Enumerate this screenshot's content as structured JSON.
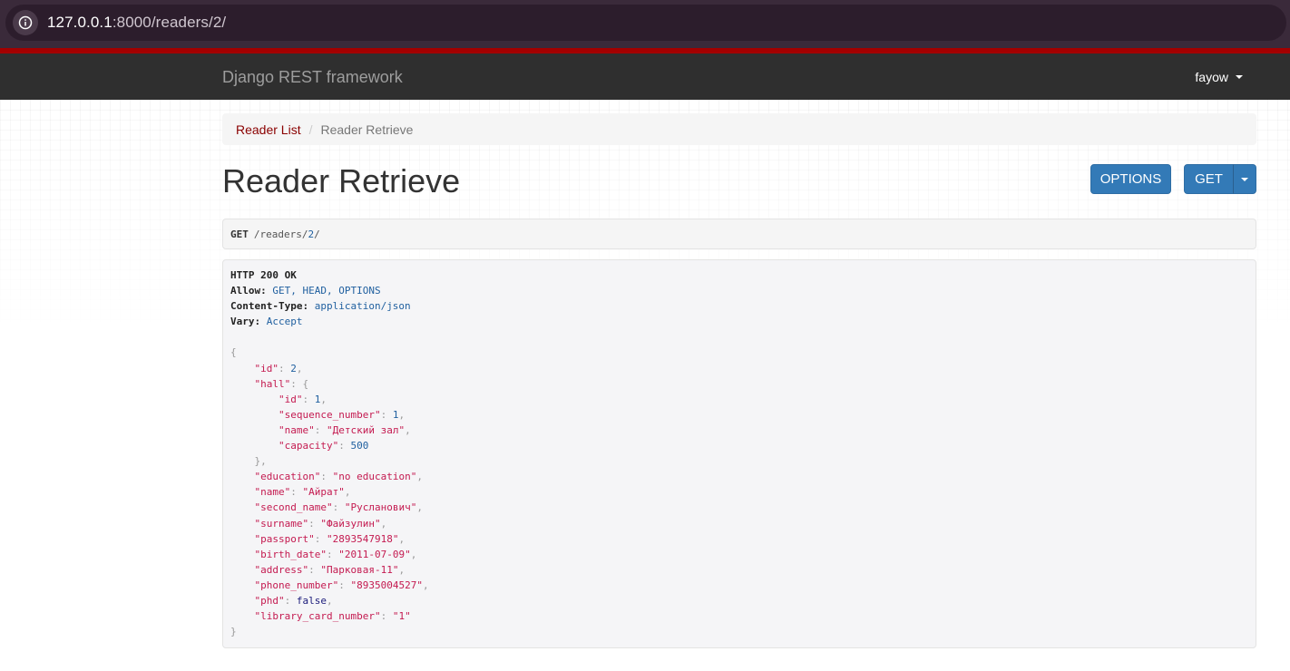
{
  "browser": {
    "url_host": "127.0.0.1",
    "url_rest": ":8000/readers/2/"
  },
  "navbar": {
    "brand": "Django REST framework",
    "user": "fayow"
  },
  "breadcrumb": {
    "link": "Reader List",
    "separator": "/",
    "active": "Reader Retrieve"
  },
  "page": {
    "title": "Reader Retrieve"
  },
  "buttons": {
    "options": "OPTIONS",
    "get": "GET"
  },
  "request": {
    "method": "GET",
    "path_prefix": "/readers/",
    "path_id": "2",
    "path_suffix": "/"
  },
  "response": {
    "status": "HTTP 200 OK",
    "headers": [
      {
        "name": "Allow:",
        "value": "GET, HEAD, OPTIONS"
      },
      {
        "name": "Content-Type:",
        "value": "application/json"
      },
      {
        "name": "Vary:",
        "value": "Accept"
      }
    ],
    "body": {
      "id": "2",
      "hall": {
        "id": "1",
        "sequence_number": "1",
        "name": "\"Детский зал\"",
        "capacity": "500"
      },
      "education": "\"no education\"",
      "name": "\"Айрат\"",
      "second_name": "\"Русланович\"",
      "surname": "\"Файзулин\"",
      "passport": "\"2893547918\"",
      "birth_date": "\"2011-07-09\"",
      "address": "\"Парковая-11\"",
      "phone_number": "\"8935004527\"",
      "phd": "false",
      "library_card_number": "\"1\""
    }
  }
}
